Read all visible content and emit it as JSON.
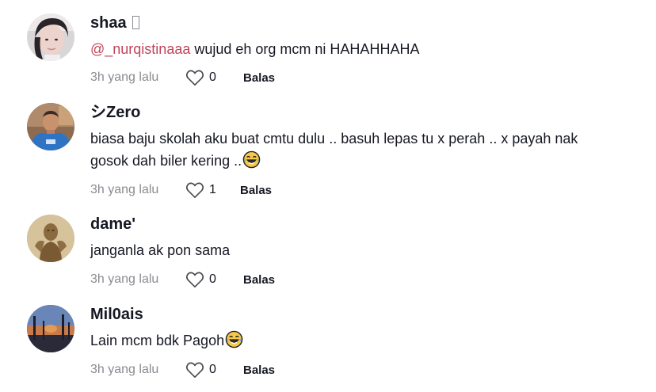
{
  "comments": [
    {
      "username": "shaa",
      "mention": "@_nurqistinaaa",
      "text": " wujud eh org mcm ni HAHAHHAHA",
      "time": "3h yang lalu",
      "likes": "0",
      "reply_label": "Balas"
    },
    {
      "username": "シZero",
      "text_line1": "biasa baju skolah aku buat cmtu dulu .. basuh lepas tu x perah .. x payah nak",
      "text_line2": "gosok dah biler kering ..",
      "time": "3h yang lalu",
      "likes": "1",
      "reply_label": "Balas"
    },
    {
      "username": "dame'",
      "text": "janganla ak pon sama",
      "time": "3h yang lalu",
      "likes": "0",
      "reply_label": "Balas"
    },
    {
      "username": "Mil0ais",
      "text": "Lain mcm bdk Pagoh",
      "time": "3h yang lalu",
      "likes": "0",
      "reply_label": "Balas"
    }
  ],
  "colors": {
    "mention": "#c1455a",
    "primary_text": "#161823",
    "secondary_text": "#8a8b91"
  },
  "icons": {
    "like": "heart-outline-icon",
    "emoji": "laughing-tears-emoji"
  }
}
